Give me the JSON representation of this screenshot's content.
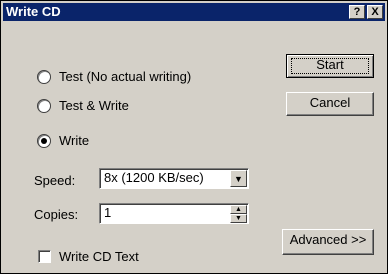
{
  "window": {
    "title": "Write CD"
  },
  "titlebar": {
    "help": "?",
    "close": "X"
  },
  "options": [
    {
      "label": "Test  (No actual writing)",
      "checked": false
    },
    {
      "label": "Test & Write",
      "checked": false
    },
    {
      "label": "Write",
      "checked": true
    }
  ],
  "speed": {
    "label": "Speed:",
    "value": "8x (1200 KB/sec)"
  },
  "copies": {
    "label": "Copies:",
    "value": "1"
  },
  "write_cd_text": {
    "label": "Write CD Text",
    "checked": false
  },
  "buttons": {
    "start": "Start",
    "cancel": "Cancel",
    "advanced": "Advanced >>"
  },
  "icons": {
    "dropdown": "▼",
    "spin_up": "▲",
    "spin_down": "▼"
  }
}
